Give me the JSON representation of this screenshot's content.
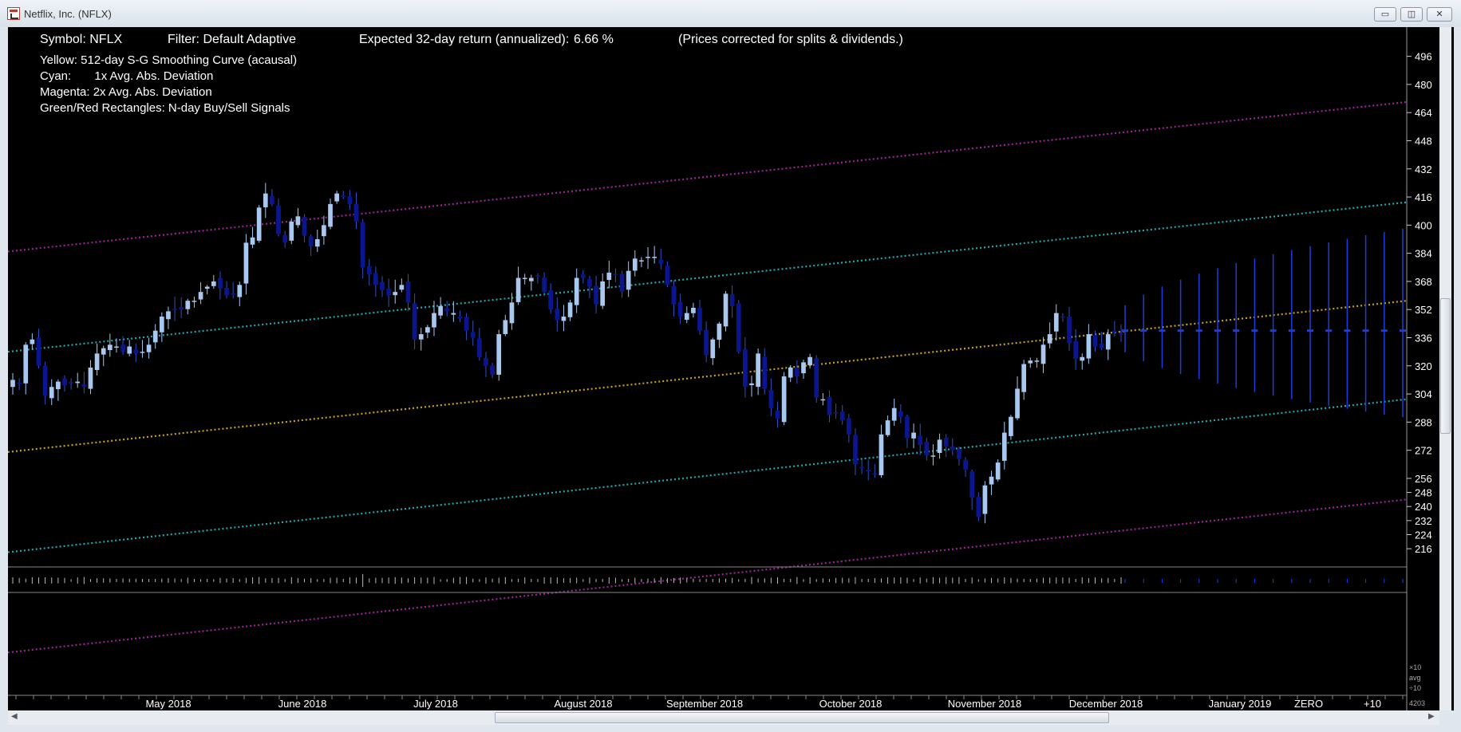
{
  "window": {
    "title": "Netflix, Inc. (NFLX)",
    "minimize_glyph": "▭",
    "maximize_glyph": "◫",
    "close_glyph": "✕"
  },
  "header": {
    "symbol": "Symbol: NFLX",
    "filter": "Filter: Default Adaptive",
    "expected_label": "Expected 32-day return (annualized):",
    "expected_value": "6.66 %",
    "note": "(Prices corrected for splits & dividends.)"
  },
  "legend": [
    "Yellow: 512-day S-G Smoothing Curve (acausal)",
    "Cyan:       1x Avg. Abs. Deviation",
    "Magenta: 2x Avg. Abs. Deviation",
    "Green/Red Rectangles: N-day Buy/Sell Signals"
  ],
  "volume_axis": [
    "×10",
    "avg",
    "÷10"
  ],
  "corner_label": "4203",
  "colors": {
    "background": "#000000",
    "up_candle": "#a8c8f0",
    "down_candle": "#0a1690",
    "smoothing": "#c8a020",
    "deviation_1x": "#20a8b0",
    "deviation_2x": "#a0209a",
    "forecast": "#1a3ce0",
    "axis_text": "#ffffff"
  },
  "chart_data": {
    "type": "candlestick",
    "y_axis_ticks": [
      496,
      480,
      464,
      448,
      432,
      416,
      400,
      384,
      368,
      352,
      336,
      320,
      304,
      288,
      272,
      256,
      248,
      240,
      232,
      224,
      216
    ],
    "ylim": [
      207,
      499
    ],
    "x_axis_labels": [
      "May 2018",
      "June 2018",
      "July 2018",
      "August 2018",
      "September 2018",
      "October 2018",
      "November 2018",
      "December 2018",
      "January 2019",
      "ZERO",
      "+10"
    ],
    "close_prices": [
      312,
      310,
      332,
      335,
      320,
      303,
      308,
      311,
      309,
      310,
      311,
      308,
      319,
      327,
      330,
      332,
      331,
      328,
      331,
      327,
      328,
      332,
      340,
      348,
      351,
      352,
      352,
      357,
      357,
      362,
      365,
      368,
      364,
      360,
      361,
      366,
      390,
      393,
      410,
      418,
      412,
      395,
      390,
      402,
      405,
      394,
      388,
      392,
      400,
      412,
      418,
      416,
      412,
      402,
      376,
      372,
      366,
      363,
      360,
      362,
      366,
      356,
      335,
      338,
      342,
      350,
      354,
      351,
      350,
      347,
      340,
      336,
      325,
      320,
      315,
      338,
      346,
      356,
      370,
      370,
      370,
      371,
      362,
      352,
      346,
      348,
      356,
      370,
      370,
      365,
      355,
      368,
      373,
      372,
      362,
      374,
      381,
      380,
      382,
      382,
      378,
      366,
      355,
      348,
      350,
      353,
      340,
      326,
      335,
      344,
      361,
      354,
      328,
      308,
      310,
      327,
      307,
      296,
      290,
      314,
      319,
      314,
      322,
      325,
      302,
      301,
      292,
      293,
      289,
      281,
      264,
      262,
      260,
      258,
      281,
      289,
      296,
      291,
      279,
      282,
      275,
      269,
      269,
      278,
      274,
      272,
      267,
      261,
      245,
      234,
      252,
      257,
      265,
      282,
      291,
      307,
      321,
      323,
      323,
      332,
      338,
      350,
      348,
      333,
      324,
      325,
      338,
      331,
      330,
      338,
      339,
      338
    ],
    "smoothing_curve": {
      "start": 271,
      "end": 357
    },
    "deviation_1x_upper": {
      "start": 328,
      "end": 413
    },
    "deviation_1x_lower": {
      "start": 214,
      "end": 301
    },
    "deviation_2x_upper": {
      "start": 385,
      "end": 470
    },
    "deviation_2x_lower": {
      "start": 157,
      "end": 244
    },
    "forecast": {
      "bars": 16,
      "center": 340,
      "max_spread": 58
    }
  }
}
